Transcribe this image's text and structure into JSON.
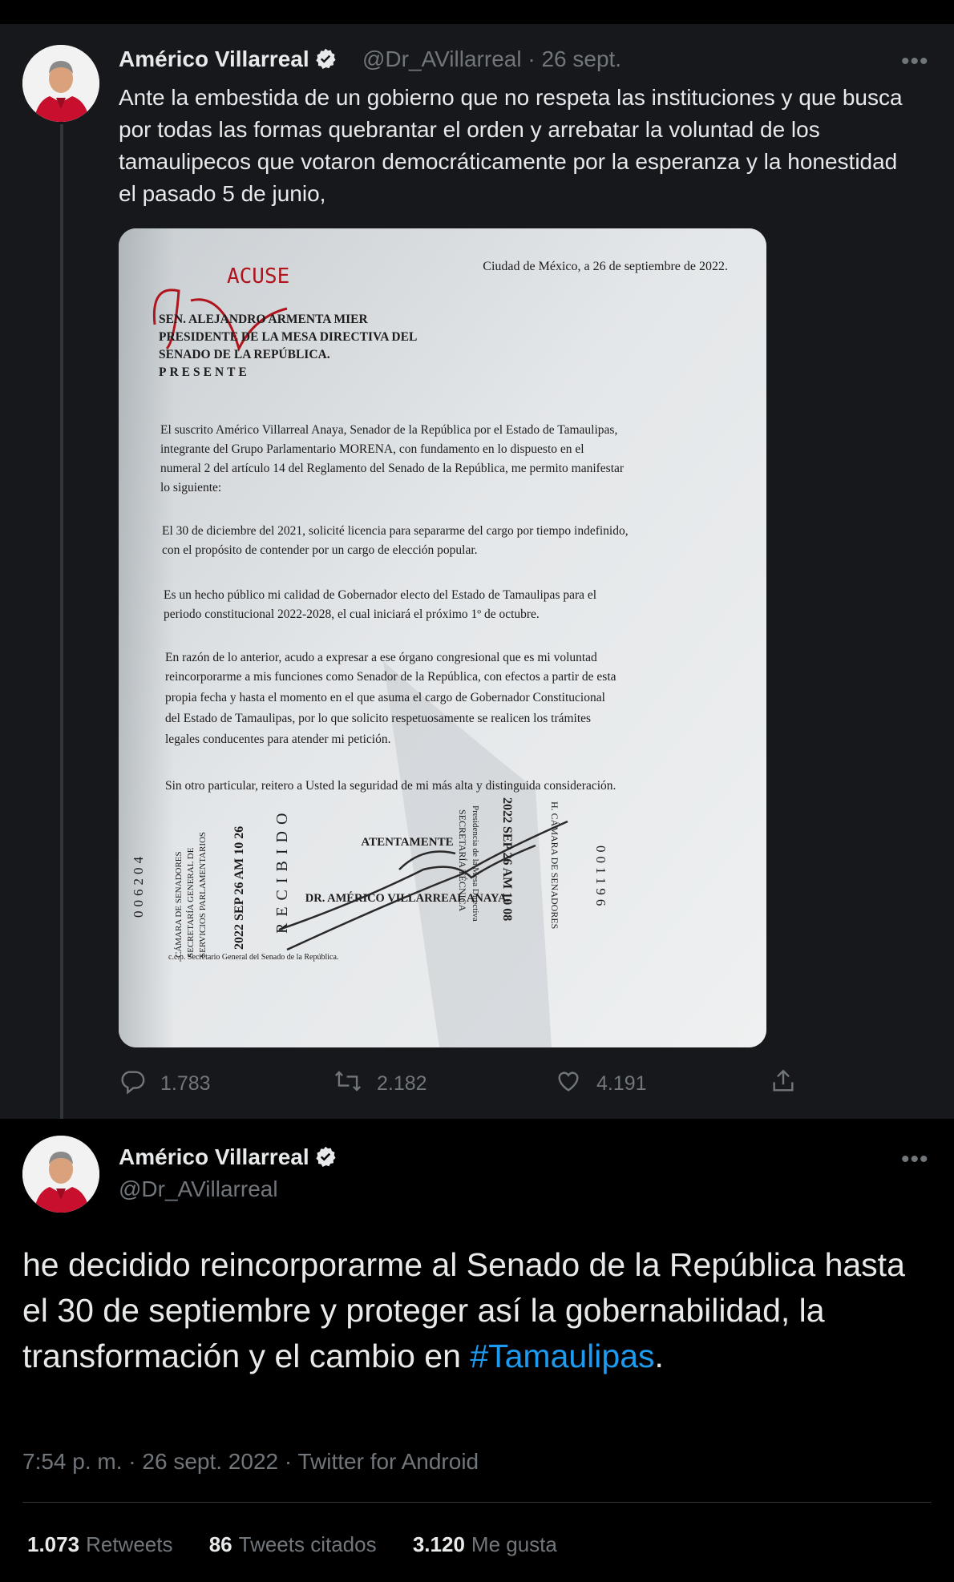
{
  "tweet1": {
    "author_name": "Américo Villarreal",
    "handle": "@Dr_AVillarreal",
    "separator": "·",
    "date": "26 sept.",
    "more": "•••",
    "text": "Ante la embestida de un gobierno que no respeta las instituciones y que busca por todas las formas quebrantar el orden y arrebatar la voluntad de los tamaulipecos que votaron democráticamente por la esperanza y la honestidad el pasado 5 de junio,",
    "actions": {
      "replies": "1.783",
      "retweets": "2.182",
      "likes": "4.191"
    }
  },
  "document": {
    "stamp_acuse": "ACUSE",
    "place_date": "Ciudad de México, a 26 de septiembre de 2022.",
    "address_lines": [
      "SEN. ALEJANDRO ARMENTA MIER",
      "PRESIDENTE DE LA MESA DIRECTIVA DEL",
      "SENADO DE LA REPÚBLICA.",
      "PRESENTE"
    ],
    "p1": [
      "El suscrito Américo Villarreal Anaya, Senador de la República por el Estado de Tamaulipas,",
      "integrante del Grupo Parlamentario MORENA, con fundamento en lo dispuesto en el",
      "numeral 2 del artículo 14 del Reglamento del Senado de la República, me permito manifestar",
      "lo siguiente:"
    ],
    "p2": [
      "El 30 de diciembre del 2021, solicité licencia para separarme del cargo por tiempo indefinido,",
      "con el propósito de contender por un cargo de elección popular."
    ],
    "p3": [
      "Es un hecho público mi calidad de Gobernador electo del Estado de Tamaulipas para el",
      "periodo constitucional 2022-2028, el cual iniciará el próximo 1º de octubre."
    ],
    "p4": [
      "En razón de lo anterior, acudo a expresar a ese órgano congresional que es mi voluntad",
      "reincorporarme a mis funciones como Senador de la República, con efectos a partir de esta",
      "propia fecha y hasta el momento en el que asuma el cargo de Gobernador Constitucional",
      "del Estado de Tamaulipas, por lo que solicito respetuosamente se realicen los trámites",
      "legales conducentes para atender mi petición."
    ],
    "p5": "Sin otro particular, reitero a Usted la seguridad de mi más alta y distinguida consideración.",
    "closing": "ATENTAMENTE",
    "signature_name": "DR. AMÉRICO VILLARREAL ANAYA.",
    "ccp": "c.c.p. Secretario General del Senado de la República.",
    "stamp_left_number": "006204",
    "stamp_left_org": [
      "CÁMARA DE SENADORES",
      "SECRETARÍA GENERAL DE",
      "SERVICIOS PARLAMENTARIOS"
    ],
    "stamp_left_date": "2022 SEP 26 AM 10 26",
    "stamp_recibido": "RECIBIDO",
    "stamp_right_org": [
      "Presidencia de la Mesa Directiva",
      "SECRETARÍA TÉCNICA"
    ],
    "stamp_right_date": "2022 SEP 26 AM 10 08",
    "stamp_right_chamber": "H. CÁMARA DE SENADORES",
    "stamp_right_number": "001196"
  },
  "tweet2": {
    "author_name": "Américo Villarreal",
    "handle": "@Dr_AVillarreal",
    "more": "•••",
    "text_main": "he decidido reincorporarme al Senado de la República hasta el 30 de septiembre y proteger así la gobernabilidad, la transformación y el cambio en ",
    "hashtag": "#Tamaulipas",
    "text_end": ".",
    "meta": "7:54 p. m. · 26 sept. 2022 · Twitter for Android",
    "stats": {
      "retweets_count": "1.073",
      "retweets_label": "Retweets",
      "quotes_count": "86",
      "quotes_label": "Tweets citados",
      "likes_count": "3.120",
      "likes_label": "Me gusta"
    }
  },
  "colors": {
    "accent": "#1d9bf0",
    "muted": "#71767b",
    "text": "#e7e9ea",
    "verified": "#e7e9ea"
  },
  "icons": [
    "reply-icon",
    "retweet-icon",
    "like-icon",
    "share-icon",
    "verified-badge-icon",
    "more-icon"
  ]
}
